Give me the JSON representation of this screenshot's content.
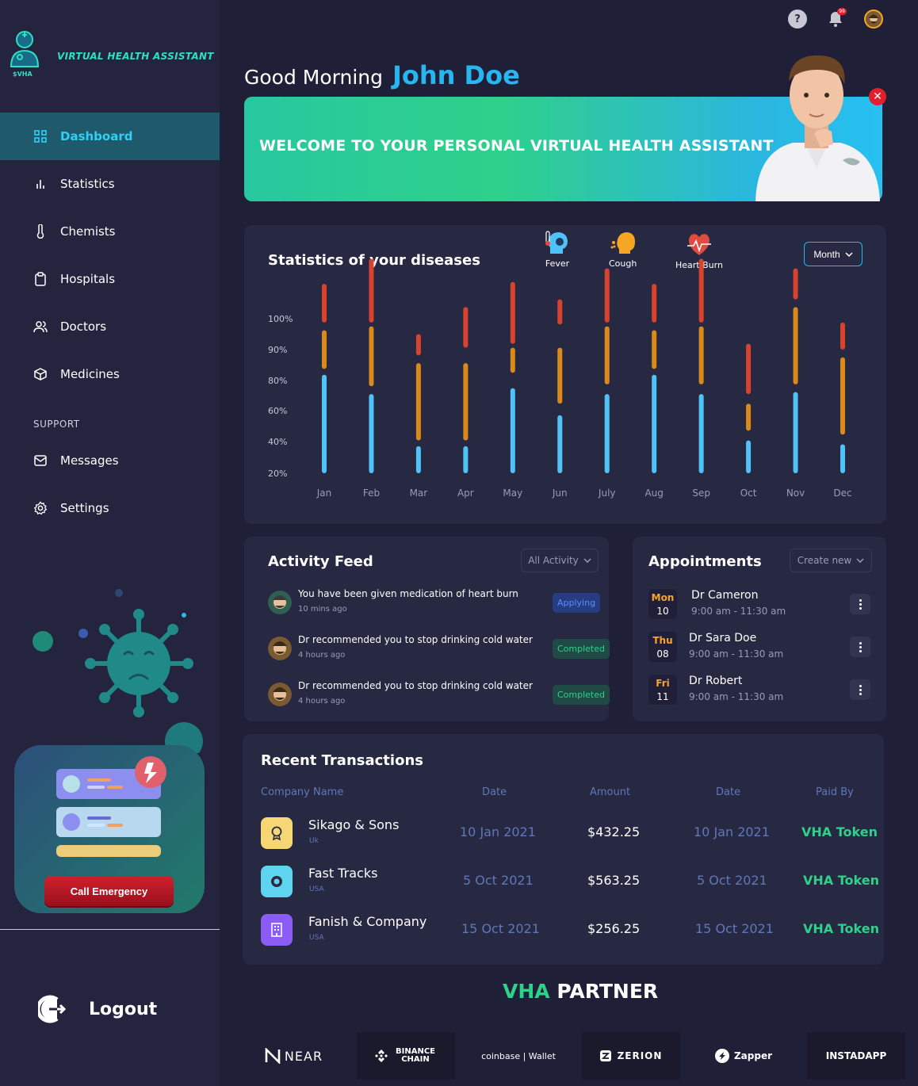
{
  "app": {
    "title": "VIRTUAL HEALTH ASSISTANT",
    "logo_caption": "$VHA"
  },
  "sidebar": {
    "items": [
      {
        "label": "Dashboard",
        "icon": "grid-icon",
        "active": true
      },
      {
        "label": "Statistics",
        "icon": "bar-chart-icon"
      },
      {
        "label": "Chemists",
        "icon": "thermometer-icon"
      },
      {
        "label": "Hospitals",
        "icon": "clipboard-icon"
      },
      {
        "label": "Doctors",
        "icon": "users-icon"
      },
      {
        "label": "Medicines",
        "icon": "box-icon"
      }
    ],
    "support_label": "SUPPORT",
    "support_items": [
      {
        "label": "Messages",
        "icon": "mail-icon"
      },
      {
        "label": "Settings",
        "icon": "gear-icon"
      }
    ],
    "emergency_button": "Call Emergency",
    "logout": "Logout"
  },
  "topbar": {
    "notification_count": "99"
  },
  "greeting": {
    "text": "Good Morning",
    "name": "John Doe"
  },
  "banner": {
    "text": "WELCOME TO YOUR PERSONAL VIRTUAL HEALTH ASSISTANT"
  },
  "stats": {
    "title": "Statistics of your diseases",
    "period": "Month",
    "legend": [
      {
        "label": "Fever",
        "color": "#4fc3f7"
      },
      {
        "label": "Cough",
        "color": "#f5a623"
      },
      {
        "label": "Heart Burn",
        "color": "#e04a3f"
      }
    ]
  },
  "chart_data": {
    "type": "bar",
    "categories": [
      "Jan",
      "Feb",
      "Mar",
      "Apr",
      "May",
      "Jun",
      "July",
      "Aug",
      "Sep",
      "Oct",
      "Nov",
      "Dec"
    ],
    "y_ticks": [
      "100%",
      "90%",
      "80%",
      "60%",
      "40%",
      "20%"
    ],
    "series": [
      {
        "name": "Fever",
        "color": "#4fc3f7",
        "segments": [
          [
            20,
            71
          ],
          [
            20,
            61
          ],
          [
            20,
            34
          ],
          [
            20,
            34
          ],
          [
            20,
            64
          ],
          [
            20,
            50
          ],
          [
            20,
            61
          ],
          [
            20,
            71
          ],
          [
            20,
            61
          ],
          [
            20,
            37
          ],
          [
            20,
            62
          ],
          [
            20,
            35
          ]
        ]
      },
      {
        "name": "Cough",
        "color": "#d98a1a",
        "segments": [
          [
            74,
            94
          ],
          [
            65,
            96
          ],
          [
            37,
            77
          ],
          [
            37,
            77
          ],
          [
            72,
            85
          ],
          [
            56,
            85
          ],
          [
            66,
            96
          ],
          [
            74,
            94
          ],
          [
            66,
            96
          ],
          [
            42,
            56
          ],
          [
            66,
            106
          ],
          [
            40,
            80
          ]
        ]
      },
      {
        "name": "Heart Burn",
        "color": "#d8432f",
        "segments": [
          [
            98,
            118
          ],
          [
            98,
            131
          ],
          [
            81,
            92
          ],
          [
            85,
            106
          ],
          [
            87,
            119
          ],
          [
            97,
            110
          ],
          [
            98,
            126
          ],
          [
            98,
            118
          ],
          [
            98,
            131
          ],
          [
            61,
            87
          ],
          [
            110,
            126
          ],
          [
            84,
            98
          ]
        ]
      }
    ]
  },
  "activity": {
    "title": "Activity Feed",
    "filter": "All Activity",
    "items": [
      {
        "text": "You have been given medication of heart burn",
        "time": "10 mins ago",
        "status": "Applying"
      },
      {
        "text": "Dr recommended you to stop drinking cold water",
        "time": "4 hours ago",
        "status": "Completed"
      },
      {
        "text": "Dr recommended you to stop drinking cold water",
        "time": "4 hours ago",
        "status": "Completed"
      }
    ]
  },
  "appointments": {
    "title": "Appointments",
    "action": "Create new",
    "items": [
      {
        "day": "Mon",
        "date": "10",
        "doctor": "Dr Cameron",
        "time": "9:00 am - 11:30 am"
      },
      {
        "day": "Thu",
        "date": "08",
        "doctor": "Dr Sara Doe",
        "time": "9:00 am - 11:30 am"
      },
      {
        "day": "Fri",
        "date": "11",
        "doctor": "Dr Robert",
        "time": "9:00 am - 11:30 am"
      }
    ]
  },
  "transactions": {
    "title": "Recent Transactions",
    "headers": [
      "Company Name",
      "Date",
      "Amount",
      "Date",
      "Paid By"
    ],
    "rows": [
      {
        "company": "Sikago & Sons",
        "country": "Uk",
        "date1": "10 Jan 2021",
        "amount": "$432.25",
        "date2": "10 Jan 2021",
        "paid_by": "VHA Token",
        "icon_color": "#f7d774"
      },
      {
        "company": "Fast Tracks",
        "country": "USA",
        "date1": "5 Oct 2021",
        "amount": "$563.25",
        "date2": "5 Oct 2021",
        "paid_by": "VHA Token",
        "icon_color": "#5fd4f0"
      },
      {
        "company": "Fanish & Company",
        "country": "USA",
        "date1": "15 Oct 2021",
        "amount": "$256.25",
        "date2": "15 Oct 2021",
        "paid_by": "VHA Token",
        "icon_color": "#8b5cf6"
      }
    ]
  },
  "partners": {
    "title_accent": "VHA",
    "title_rest": "PARTNER",
    "items": [
      "NEAR",
      "BINANCE CHAIN",
      "coinbase | Wallet",
      "ZERION",
      "Zapper",
      "INSTADAPP"
    ]
  }
}
